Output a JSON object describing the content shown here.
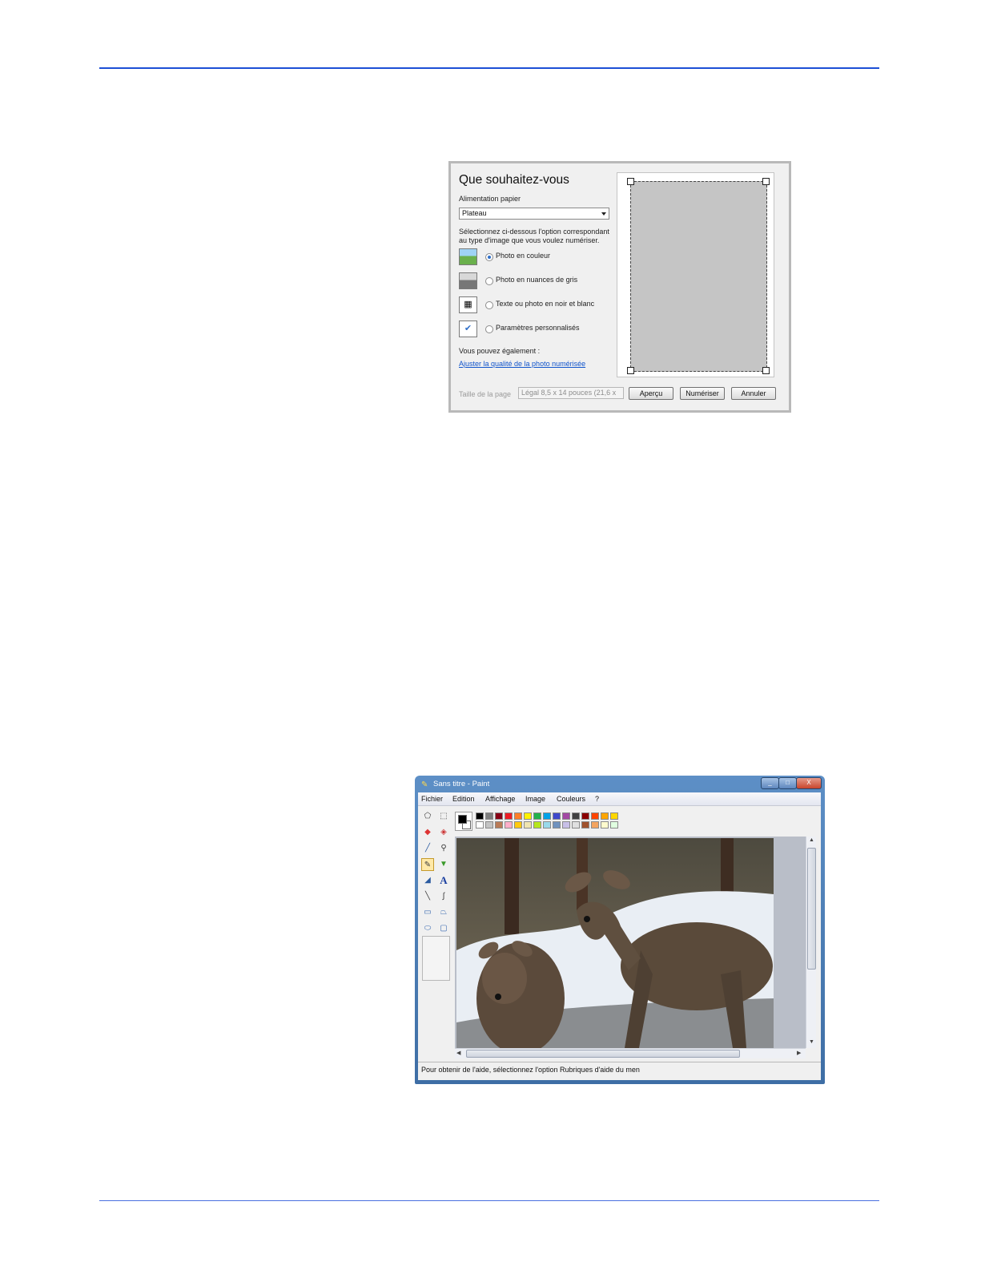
{
  "scan_dialog": {
    "title": "Que souhaitez-vous",
    "paper_feed_label": "Alimentation papier",
    "paper_feed_value": "Plateau",
    "instruction": "Sélectionnez ci-dessous l'option correspondant au type d'image que vous voulez numériser.",
    "options": [
      {
        "label": "Photo en couleur",
        "icon": "color-photo-icon",
        "selected": true
      },
      {
        "label": "Photo en nuances de gris",
        "icon": "grayscale-photo-icon",
        "selected": false
      },
      {
        "label": "Texte ou photo en noir et blanc",
        "icon": "bw-text-icon",
        "selected": false
      },
      {
        "label": "Paramètres personnalisés",
        "icon": "custom-settings-icon",
        "selected": false
      }
    ],
    "also_label": "Vous pouvez également :",
    "adjust_link": "Ajuster la qualité de la photo numérisée",
    "page_size_label": "Taille de la page",
    "page_size_value": "Légal 8,5 x 14 pouces (21,6 x",
    "buttons": {
      "preview": "Aperçu",
      "scan": "Numériser",
      "cancel": "Annuler"
    }
  },
  "paint_window": {
    "title": "Sans titre - Paint",
    "menu": [
      "Fichier",
      "Edition",
      "Affichage",
      "Image",
      "Couleurs",
      "?"
    ],
    "window_buttons": {
      "minimize": "_",
      "maximize": "□",
      "close": "X"
    },
    "palette_top": [
      "#000000",
      "#7f7f7f",
      "#880015",
      "#ed1c24",
      "#ff7f27",
      "#fff200",
      "#22b14c",
      "#00a2e8",
      "#3f48cc",
      "#a349a4",
      "#404040",
      "#8b0000",
      "#ff4500",
      "#ffa500",
      "#ffd700",
      "#9acd32",
      "#00ced1",
      "#4169e1",
      "#8a2be2",
      "#6a0dad"
    ],
    "palette_bottom": [
      "#ffffff",
      "#c3c3c3",
      "#b97a57",
      "#ffaec9",
      "#ffc90e",
      "#efe4b0",
      "#b5e61d",
      "#99d9ea",
      "#7092be",
      "#c8bfe7",
      "#e0e0e0",
      "#a0522d",
      "#f4a460",
      "#fffacd",
      "#e0ffe0",
      "#98fb98",
      "#add8e6",
      "#6495ed",
      "#b0c4de",
      "#d8bfd8"
    ],
    "status_text": "Pour obtenir de l'aide, sélectionnez l'option Rubriques d'aide du men"
  }
}
